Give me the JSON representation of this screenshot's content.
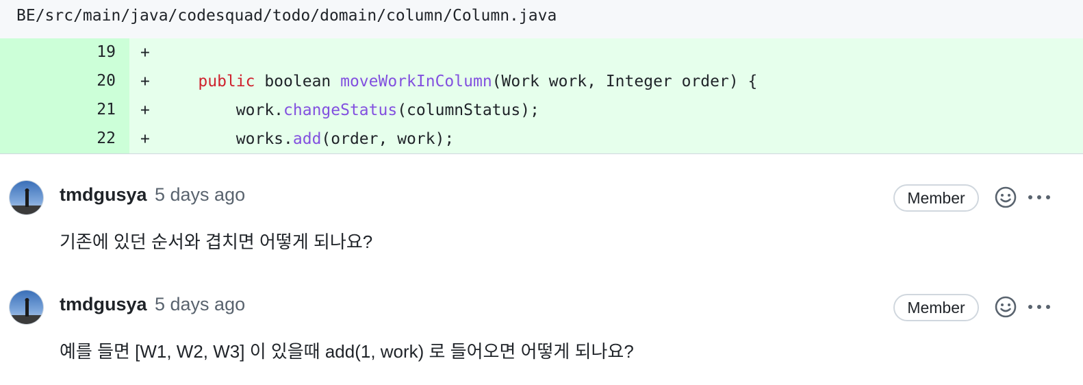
{
  "file": {
    "path": "BE/src/main/java/codesquad/todo/domain/column/Column.java"
  },
  "diff": {
    "lines": [
      {
        "num": "19",
        "marker": "+",
        "indent": "",
        "parts": []
      },
      {
        "num": "20",
        "marker": "+",
        "indent": "    ",
        "parts": [
          {
            "text": "public",
            "cls": "kw"
          },
          {
            "text": " boolean ",
            "cls": ""
          },
          {
            "text": "moveWorkInColumn",
            "cls": "fn"
          },
          {
            "text": "(Work work, Integer order) {",
            "cls": ""
          }
        ]
      },
      {
        "num": "21",
        "marker": "+",
        "indent": "        ",
        "parts": [
          {
            "text": "work.",
            "cls": ""
          },
          {
            "text": "changeStatus",
            "cls": "fn"
          },
          {
            "text": "(columnStatus);",
            "cls": ""
          }
        ]
      },
      {
        "num": "22",
        "marker": "+",
        "indent": "        ",
        "parts": [
          {
            "text": "works.",
            "cls": ""
          },
          {
            "text": "add",
            "cls": "fn"
          },
          {
            "text": "(order, work);",
            "cls": ""
          }
        ]
      }
    ]
  },
  "comments": [
    {
      "author": "tmdgusya",
      "time": "5 days ago",
      "badge": "Member",
      "body": "기존에 있던 순서와 겹치면 어떻게 되나요?"
    },
    {
      "author": "tmdgusya",
      "time": "5 days ago",
      "badge": "Member",
      "body": "예를 들면 [W1, W2, W3] 이 있을때 add(1, work) 로 들어오면 어떻게 되나요?"
    }
  ],
  "icons": {
    "avatar": "user-avatar",
    "emoji": "smiley-icon",
    "more": "kebab-horizontal-icon"
  },
  "colors": {
    "addition_gutter": "#ccffd8",
    "addition_line": "#e6ffec",
    "keyword": "#cf222e",
    "function": "#8250df"
  }
}
